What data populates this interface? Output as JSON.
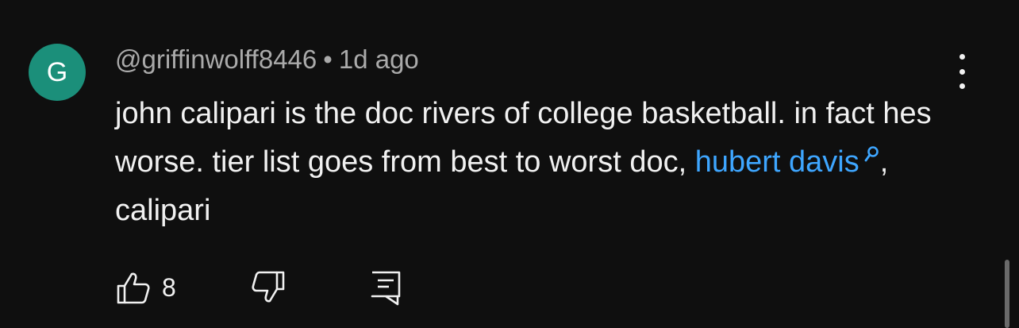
{
  "comment": {
    "avatar_initial": "G",
    "author": "@griffinwolff8446",
    "separator": "•",
    "time": "1d ago",
    "text_before_link": "john calipari is the doc rivers of college basketball. in fact hes worse. tier list goes from best to worst doc,",
    "link_text": "hubert davis",
    "text_after_link": ", calipari",
    "like_count": "8"
  },
  "icons": {
    "menu": "more-vert-icon",
    "like": "thumbs-up-icon",
    "dislike": "thumbs-down-icon",
    "reply": "reply-icon",
    "link_search": "search-icon"
  },
  "colors": {
    "background": "#0f0f0f",
    "avatar": "#1b8f7a",
    "link": "#3ea6ff",
    "text": "#f1f1f1",
    "meta": "#aaaaaa"
  }
}
